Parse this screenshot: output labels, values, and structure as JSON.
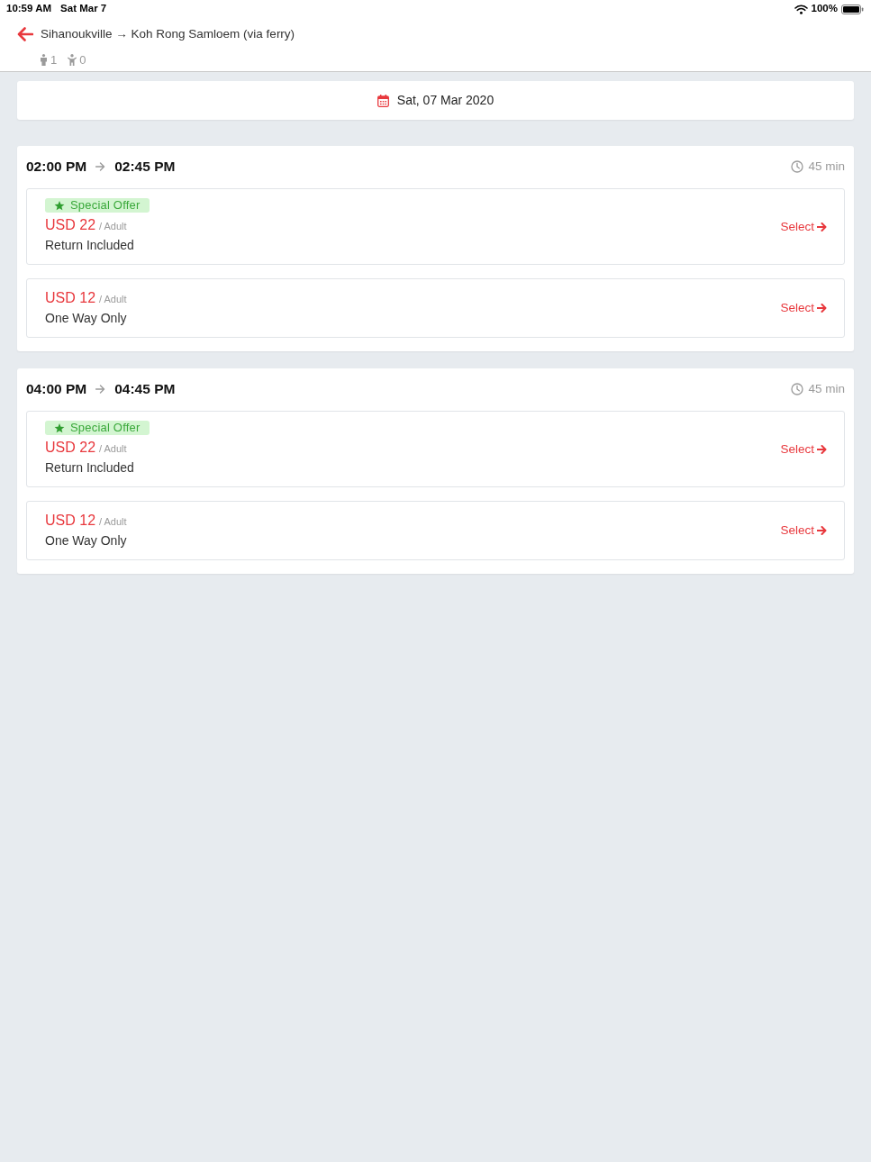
{
  "status_bar": {
    "time": "10:59 AM",
    "date": "Sat Mar 7",
    "battery": "100%"
  },
  "header": {
    "title": "Sihanoukville → Koh Rong Samloem (via ferry)",
    "adults": "1",
    "children": "0"
  },
  "date_picker": {
    "label": "Sat, 07 Mar 2020"
  },
  "departures": [
    {
      "depart": "02:00 PM",
      "arrive": "02:45 PM",
      "duration": "45 min",
      "fares": [
        {
          "badge": "Special Offer",
          "price": "USD 22",
          "unit": "/ Adult",
          "note": "Return Included",
          "action": "Select"
        },
        {
          "price": "USD 12",
          "unit": "/ Adult",
          "note": "One Way Only",
          "action": "Select"
        }
      ]
    },
    {
      "depart": "04:00 PM",
      "arrive": "04:45 PM",
      "duration": "45 min",
      "fares": [
        {
          "badge": "Special Offer",
          "price": "USD 22",
          "unit": "/ Adult",
          "note": "Return Included",
          "action": "Select"
        },
        {
          "price": "USD 12",
          "unit": "/ Adult",
          "note": "One Way Only",
          "action": "Select"
        }
      ]
    }
  ]
}
